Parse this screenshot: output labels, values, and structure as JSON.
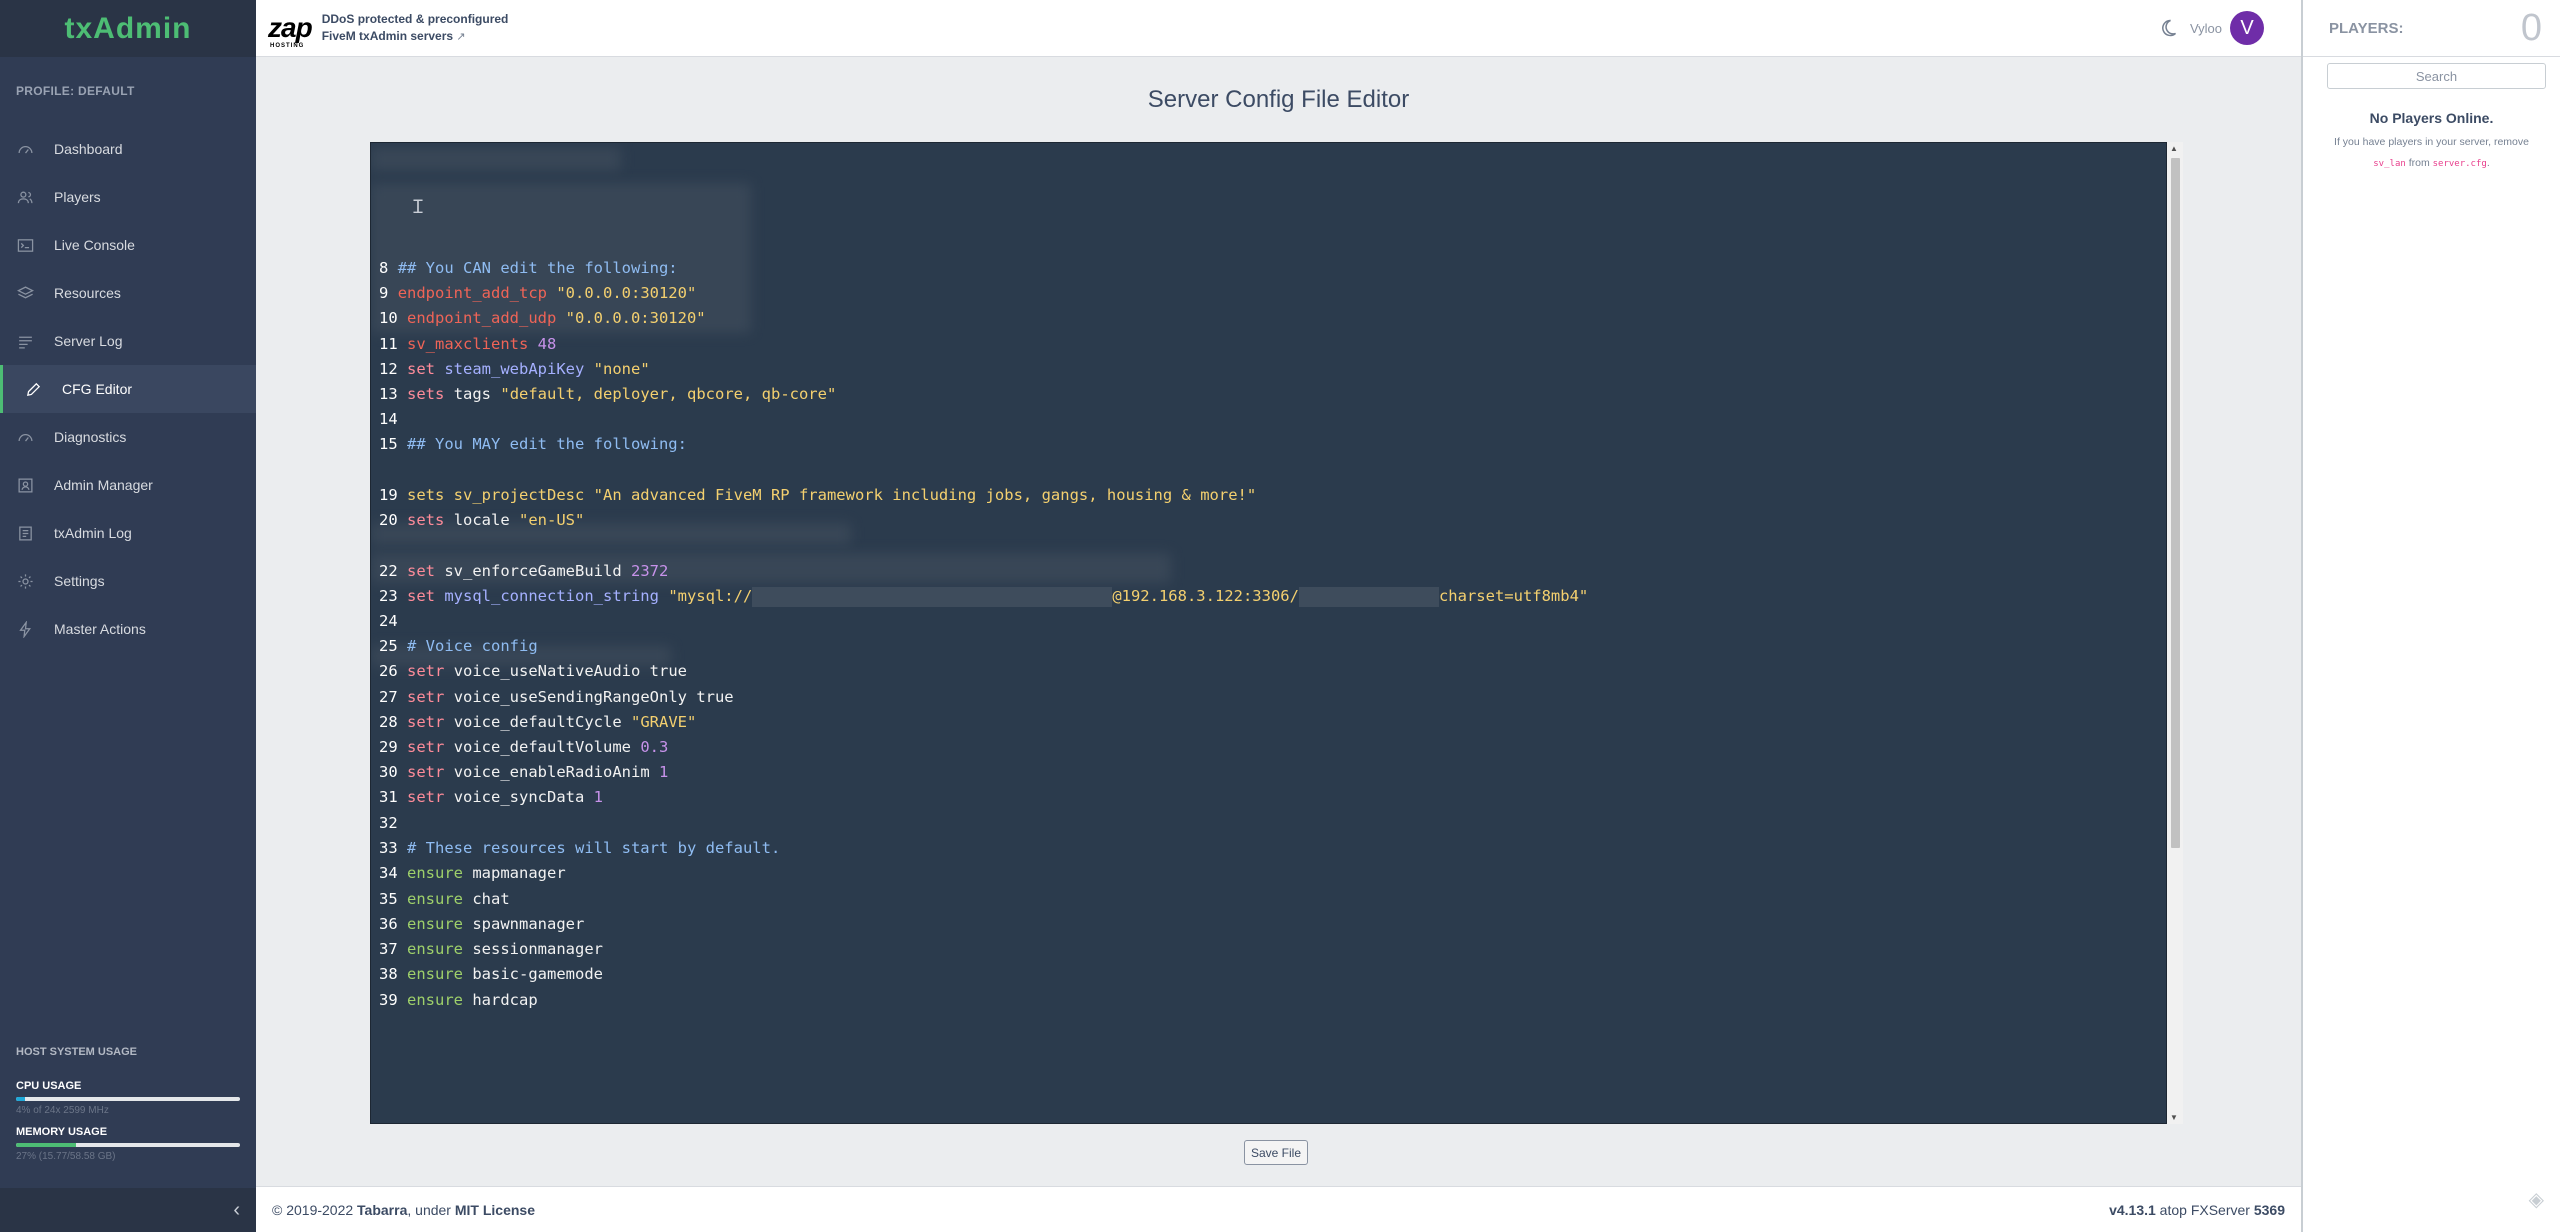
{
  "sidebar": {
    "brand": "txAdmin",
    "profile_label": "PROFILE: DEFAULT",
    "items": [
      {
        "label": "Dashboard",
        "icon": "speedometer-icon"
      },
      {
        "label": "Players",
        "icon": "people-icon"
      },
      {
        "label": "Live Console",
        "icon": "terminal-icon"
      },
      {
        "label": "Resources",
        "icon": "layers-icon"
      },
      {
        "label": "Server Log",
        "icon": "list-icon"
      },
      {
        "label": "CFG Editor",
        "icon": "pencil-icon",
        "active": true
      },
      {
        "label": "Diagnostics",
        "icon": "speedometer-icon"
      },
      {
        "label": "Admin Manager",
        "icon": "contact-icon"
      },
      {
        "label": "txAdmin Log",
        "icon": "notes-icon"
      },
      {
        "label": "Settings",
        "icon": "gear-icon"
      },
      {
        "label": "Master Actions",
        "icon": "bolt-icon"
      }
    ],
    "usage": {
      "header": "HOST SYSTEM USAGE",
      "cpu_title": "CPU USAGE",
      "cpu_sub": "4% of 24x 2599 MHz",
      "cpu_fraction": 0.04,
      "cpu_color": "#20a8d8",
      "mem_title": "MEMORY USAGE",
      "mem_sub": "27% (15.77/58.58 GB)",
      "mem_fraction": 0.27,
      "mem_color": "#4dbd74"
    },
    "collapse_icon": "‹"
  },
  "header": {
    "logo_text": "zap",
    "logo_sub": "HOSTING",
    "promo_line1": "DDoS protected & preconfigured",
    "promo_line2": "FiveM txAdmin servers",
    "promo_ext": "↗",
    "username": "Vyloo",
    "avatar_letter": "V",
    "avatar_color": "#6f2da8"
  },
  "main": {
    "title": "Server Config File Editor",
    "save_label": "Save File"
  },
  "editor": {
    "lines": [
      {
        "n": "8",
        "parts": [
          {
            "t": "## You CAN edit the following:",
            "c": "t-comment"
          }
        ]
      },
      {
        "n": "9",
        "parts": [
          {
            "t": "endpoint_add_tcp ",
            "c": "t-red"
          },
          {
            "t": "\"0.0.0.0:30120\"",
            "c": "t-str"
          }
        ]
      },
      {
        "n": "10",
        "parts": [
          {
            "t": "endpoint_add_udp ",
            "c": "t-red"
          },
          {
            "t": "\"0.0.0.0:30120\"",
            "c": "t-str"
          }
        ]
      },
      {
        "n": "11",
        "parts": [
          {
            "t": "sv_maxclients ",
            "c": "t-red"
          },
          {
            "t": "48",
            "c": "t-num"
          }
        ]
      },
      {
        "n": "12",
        "parts": [
          {
            "t": "set ",
            "c": "t-kw"
          },
          {
            "t": "steam_webApiKey ",
            "c": "t-var"
          },
          {
            "t": "\"none\"",
            "c": "t-str"
          }
        ]
      },
      {
        "n": "13",
        "parts": [
          {
            "t": "sets ",
            "c": "t-kw"
          },
          {
            "t": "tags ",
            "c": "t-plain"
          },
          {
            "t": "\"default, deployer, qbcore, qb-core\"",
            "c": "t-str"
          }
        ]
      },
      {
        "n": "14",
        "parts": []
      },
      {
        "n": "15",
        "parts": [
          {
            "t": "## You MAY edit the following:",
            "c": "t-comment"
          }
        ]
      },
      {
        "n": "19",
        "parts": [
          {
            "t": "sets sv_projectDesc \"An advanced FiveM RP framework including jobs, gangs, housing & more!\"",
            "c": "t-str"
          }
        ]
      },
      {
        "n": "20",
        "parts": [
          {
            "t": "sets ",
            "c": "t-kw"
          },
          {
            "t": "locale ",
            "c": "t-plain"
          },
          {
            "t": "\"en-US\"",
            "c": "t-str"
          }
        ]
      },
      {
        "n": "22",
        "parts": [
          {
            "t": "set ",
            "c": "t-kw"
          },
          {
            "t": "sv_enforceGameBuild ",
            "c": "t-plain"
          },
          {
            "t": "2372",
            "c": "t-num"
          }
        ]
      },
      {
        "n": "23",
        "parts": [
          {
            "t": "set ",
            "c": "t-kw"
          },
          {
            "t": "mysql_connection_string ",
            "c": "t-var"
          },
          {
            "t": "\"mysql://",
            "c": "t-str"
          },
          {
            "redact": 360
          },
          {
            "t": "@192.168.3.122:3306/",
            "c": "t-str"
          },
          {
            "redact": 140
          },
          {
            "t": "charset=utf8mb4\"",
            "c": "t-str"
          }
        ]
      },
      {
        "n": "24",
        "parts": []
      },
      {
        "n": "25",
        "parts": [
          {
            "t": "# Voice config",
            "c": "t-comment"
          }
        ]
      },
      {
        "n": "26",
        "parts": [
          {
            "t": "setr ",
            "c": "t-kw"
          },
          {
            "t": "voice_useNativeAudio true",
            "c": "t-plain"
          }
        ]
      },
      {
        "n": "27",
        "parts": [
          {
            "t": "setr ",
            "c": "t-kw"
          },
          {
            "t": "voice_useSendingRangeOnly true",
            "c": "t-plain"
          }
        ]
      },
      {
        "n": "28",
        "parts": [
          {
            "t": "setr ",
            "c": "t-kw"
          },
          {
            "t": "voice_defaultCycle ",
            "c": "t-plain"
          },
          {
            "t": "\"GRAVE\"",
            "c": "t-str"
          }
        ]
      },
      {
        "n": "29",
        "parts": [
          {
            "t": "setr ",
            "c": "t-kw"
          },
          {
            "t": "voice_defaultVolume ",
            "c": "t-plain"
          },
          {
            "t": "0.3",
            "c": "t-num"
          }
        ]
      },
      {
        "n": "30",
        "parts": [
          {
            "t": "setr ",
            "c": "t-kw"
          },
          {
            "t": "voice_enableRadioAnim ",
            "c": "t-plain"
          },
          {
            "t": "1",
            "c": "t-num"
          }
        ]
      },
      {
        "n": "31",
        "parts": [
          {
            "t": "setr ",
            "c": "t-kw"
          },
          {
            "t": "voice_syncData ",
            "c": "t-plain"
          },
          {
            "t": "1",
            "c": "t-num"
          }
        ]
      },
      {
        "n": "32",
        "parts": []
      },
      {
        "n": "33",
        "parts": [
          {
            "t": "# These resources will start by default.",
            "c": "t-comment"
          }
        ]
      },
      {
        "n": "34",
        "parts": [
          {
            "t": "ensure ",
            "c": "t-green"
          },
          {
            "t": "mapmanager",
            "c": "t-plain"
          }
        ]
      },
      {
        "n": "35",
        "parts": [
          {
            "t": "ensure ",
            "c": "t-green"
          },
          {
            "t": "chat",
            "c": "t-plain"
          }
        ]
      },
      {
        "n": "36",
        "parts": [
          {
            "t": "ensure ",
            "c": "t-green"
          },
          {
            "t": "spawnmanager",
            "c": "t-plain"
          }
        ]
      },
      {
        "n": "37",
        "parts": [
          {
            "t": "ensure ",
            "c": "t-green"
          },
          {
            "t": "sessionmanager",
            "c": "t-plain"
          }
        ]
      },
      {
        "n": "38",
        "parts": [
          {
            "t": "ensure ",
            "c": "t-green"
          },
          {
            "t": "basic-gamemode",
            "c": "t-plain"
          }
        ]
      },
      {
        "n": "39",
        "parts": [
          {
            "t": "ensure ",
            "c": "t-green"
          },
          {
            "t": "hardcap",
            "c": "t-plain"
          }
        ]
      }
    ]
  },
  "footer": {
    "copyright_prefix": "© 2019-2022 ",
    "author": "Tabarra",
    "under": ", under ",
    "license": "MIT License",
    "version": "v4.13.1",
    "atop": " atop FXServer ",
    "fxserver": "5369"
  },
  "players": {
    "label": "PLAYERS:",
    "count": "0",
    "search_placeholder": "Search",
    "empty_title": "No Players Online.",
    "hint_prefix": "If you have players in your server, remove",
    "hint_code1": "sv_lan",
    "hint_mid": " from ",
    "hint_code2": "server.cfg",
    "hint_suffix": "."
  }
}
